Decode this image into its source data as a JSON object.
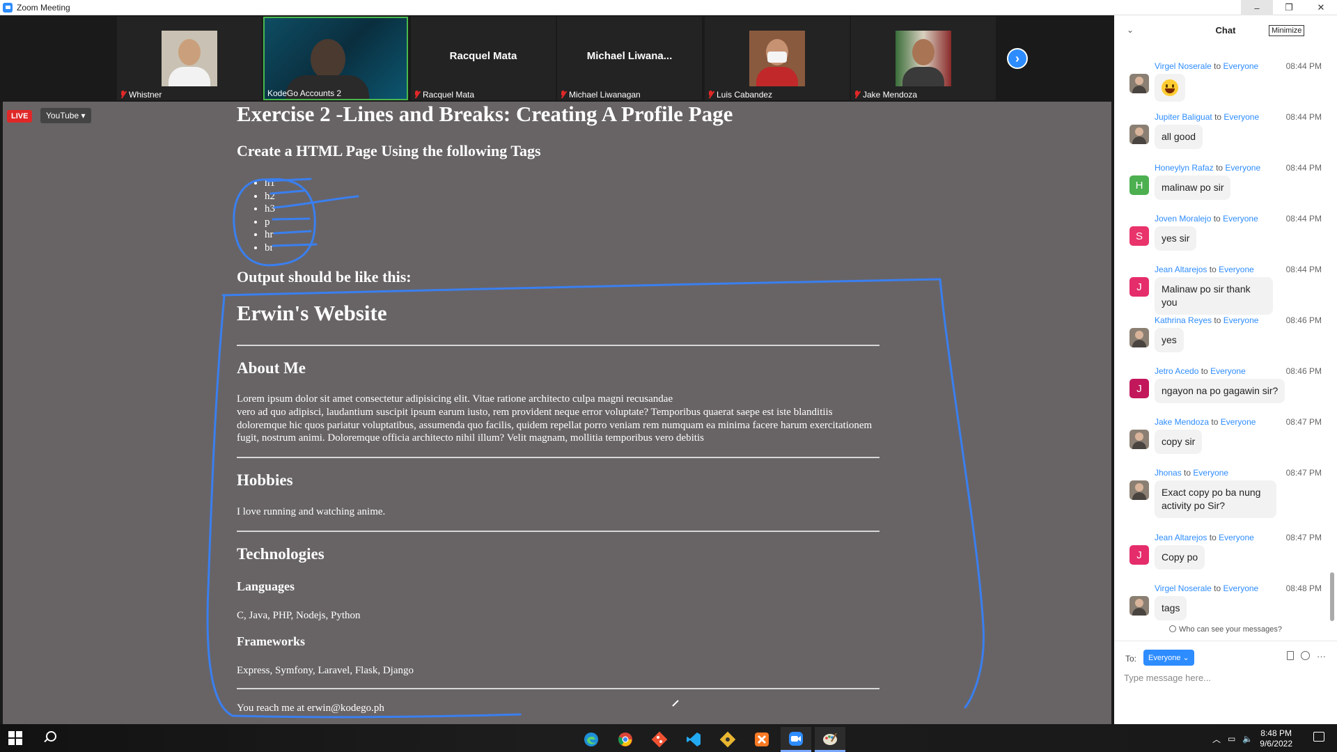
{
  "window": {
    "title": "Zoom Meeting",
    "buttons": [
      "–",
      "❐",
      "✕"
    ]
  },
  "participants": [
    {
      "name": "Whistner",
      "video": true,
      "muted": true
    },
    {
      "name": "KodeGo Accounts 2",
      "video": true,
      "muted": false,
      "active_speaker": true
    },
    {
      "name": "Racquel Mata",
      "video": false,
      "display": "Racquel Mata",
      "muted": true
    },
    {
      "name": "Michael Liwanagan",
      "video": false,
      "display": "Michael  Liwana...",
      "muted": true
    },
    {
      "name": "Luis Cabandez",
      "video": true,
      "muted": true
    },
    {
      "name": "Jake Mendoza",
      "video": true,
      "muted": true
    }
  ],
  "share": {
    "live_label": "LIVE",
    "stream_label": "YouTube ▾",
    "exercise_title": "Exercise 2 -Lines and Breaks: Creating A Profile Page",
    "subtitle": "Create a HTML Page Using the following Tags",
    "tags": [
      "h1",
      "h2",
      "h3",
      "p",
      "hr",
      "br"
    ],
    "output_label": "Output should be like this:",
    "site_title": "Erwin's Website",
    "about_heading": "About Me",
    "about_text_1": "Lorem ipsum dolor sit amet consectetur adipisicing elit. Vitae ratione architecto culpa magni recusandae",
    "about_text_2": "vero ad quo adipisci, laudantium suscipit ipsum earum iusto, rem provident neque error voluptate? Temporibus quaerat saepe est iste blanditiis doloremque hic quos pariatur voluptatibus, assumenda quo facilis, quidem repellat porro veniam rem numquam ea minima facere harum exercitationem fugit, nostrum animi. Doloremque officia architecto nihil illum? Velit magnam, mollitia temporibus vero debitis",
    "hobbies_heading": "Hobbies",
    "hobbies_text": "I love running and watching anime.",
    "tech_heading": "Technologies",
    "languages_heading": "Languages",
    "languages_text": "C, Java, PHP, Nodejs, Python",
    "frameworks_heading": "Frameworks",
    "frameworks_text": "Express, Symfony, Laravel, Flask, Django",
    "contact_text": "You reach me at erwin@kodego.ph"
  },
  "chat": {
    "title": "Chat",
    "tooltip": "Minimize",
    "messages": [
      {
        "sender": "Virgel Noserale",
        "to": "to",
        "audience": "Everyone",
        "time": "08:44 PM",
        "text": "",
        "emoji": "grinning-emoji",
        "avatar": "photo"
      },
      {
        "sender": "Jupiter Baliguat",
        "to": "to",
        "audience": "Everyone",
        "time": "08:44 PM",
        "text": "all good",
        "avatar": "photo"
      },
      {
        "sender": "Honeylyn Rafaz",
        "to": "to",
        "audience": "Everyone",
        "time": "08:44 PM",
        "text": "malinaw po sir",
        "avatar": "H",
        "avatar_color": "#4caf50"
      },
      {
        "sender": "Joven Moralejo",
        "to": "to",
        "audience": "Everyone",
        "time": "08:44 PM",
        "text": "yes sir",
        "avatar": "S",
        "avatar_color": "#e9336b"
      },
      {
        "sender": "Jean Altarejos",
        "to": "to",
        "audience": "Everyone",
        "time": "08:44 PM",
        "text": "Malinaw po sir thank you",
        "avatar": "J",
        "avatar_color": "#e52d6b"
      },
      {
        "sender": "Kathrina Reyes",
        "to": "to",
        "audience": "Everyone",
        "time": "08:46 PM",
        "text": "yes",
        "avatar": "photo"
      },
      {
        "sender": "Jetro Acedo",
        "to": "to",
        "audience": "Everyone",
        "time": "08:46 PM",
        "text": "ngayon na po gagawin sir?",
        "avatar": "J",
        "avatar_color": "#c2185b"
      },
      {
        "sender": "Jake Mendoza",
        "to": "to",
        "audience": "Everyone",
        "time": "08:47 PM",
        "text": "copy sir",
        "avatar": "photo"
      },
      {
        "sender": "Jhonas",
        "to": "to",
        "audience": "Everyone",
        "time": "08:47 PM",
        "text": "Exact copy po ba nung activity po Sir?",
        "avatar": "photo"
      },
      {
        "sender": "Jean Altarejos",
        "to": "to",
        "audience": "Everyone",
        "time": "08:47 PM",
        "text": "Copy po",
        "avatar": "J",
        "avatar_color": "#e52d6b"
      },
      {
        "sender": "Virgel Noserale",
        "to": "to",
        "audience": "Everyone",
        "time": "08:48 PM",
        "text": "tags",
        "avatar": "photo"
      }
    ],
    "who_can_see": "Who can see your messages?",
    "to_label": "To:",
    "to_value": "Everyone ⌄",
    "input_placeholder": "Type message here..."
  },
  "taskbar": {
    "apps": [
      "edge-icon",
      "chrome-icon",
      "git-icon",
      "vscode-icon",
      "sourcetree-icon",
      "xampp-icon",
      "zoom-icon",
      "paint-icon"
    ],
    "time": "8:48 PM",
    "date": "9/6/2022"
  },
  "colors": {
    "zoom_blue": "#2d8cff",
    "share_bg": "#686466",
    "annotation_blue": "#3a7ff0",
    "live_red": "#e02828"
  }
}
